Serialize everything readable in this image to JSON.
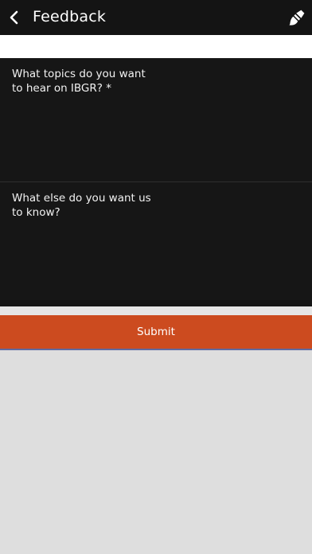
{
  "header": {
    "title": "Feedback",
    "back_icon": "chevron-left-icon",
    "action_icon": "paintbrush-icon"
  },
  "form": {
    "fields": [
      {
        "label": "What topics do you want to hear on IBGR? *",
        "value": ""
      },
      {
        "label": "What else do you want us to know?",
        "value": ""
      }
    ],
    "submit_label": "Submit"
  },
  "colors": {
    "header_bg": "#141414",
    "field_bg": "#161616",
    "submit_bg": "#cc4b1f",
    "page_bg": "#dedede"
  }
}
